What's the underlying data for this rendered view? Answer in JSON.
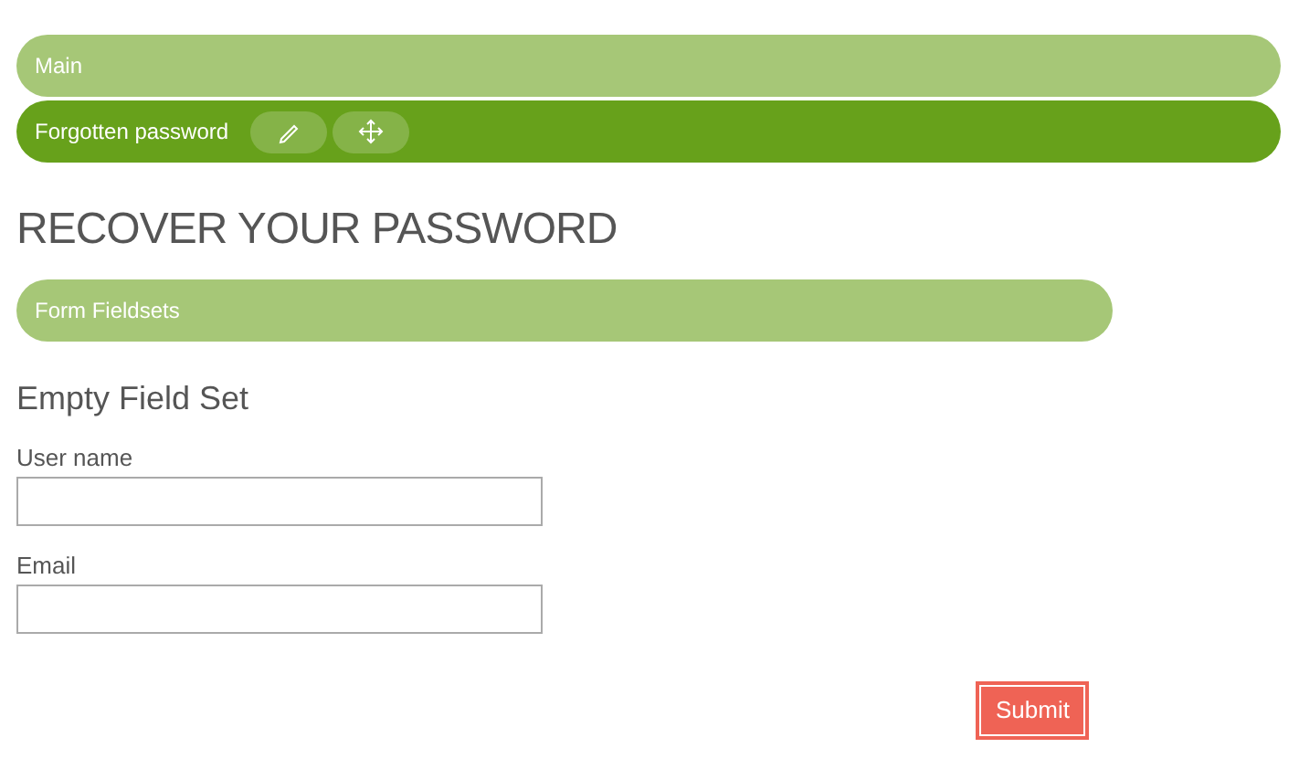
{
  "bars": [
    {
      "label": "Main",
      "selected": false
    },
    {
      "label": "Forgotten password",
      "selected": true,
      "tools": [
        {
          "kind": "edit"
        },
        {
          "kind": "move"
        }
      ]
    }
  ],
  "heading": "RECOVER YOUR PASSWORD",
  "section_bar": {
    "label": "Form Fieldsets"
  },
  "fieldset": {
    "legend": "Empty Field Set",
    "fields": [
      {
        "label": "User name"
      },
      {
        "label": "Email"
      }
    ]
  },
  "submit": "Submit"
}
